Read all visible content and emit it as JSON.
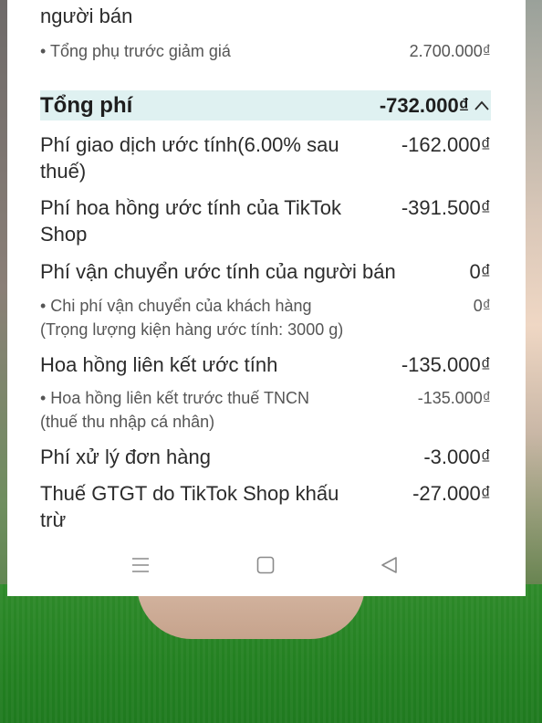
{
  "top_partial": {
    "line2": "người bán"
  },
  "subtotal": {
    "label": "• Tổng phụ trước giảm giá",
    "value": "2.700.000₫"
  },
  "total": {
    "label": "Tổng phí",
    "value": "-732.000₫"
  },
  "fees": [
    {
      "label_line1": "Phí giao dịch ước tính(6.00% sau",
      "label_line2": "thuế)",
      "value": "-162.000₫"
    },
    {
      "label_line1": "Phí hoa hồng ước tính của TikTok",
      "label_line2": "Shop",
      "value": "-391.500₫"
    },
    {
      "label_line1": "Phí vận chuyển ước tính của người bán",
      "value": "0₫"
    }
  ],
  "shipping_sub": {
    "label_line1": "• Chi phí vận chuyển của khách hàng",
    "label_line2": "(Trọng lượng kiện hàng ước tính: 3000 g)",
    "value": "0₫"
  },
  "affiliate": {
    "label": "Hoa hồng liên kết ước tính",
    "value": "-135.000₫"
  },
  "affiliate_sub": {
    "label_line1": "• Hoa hồng liên kết trước thuế TNCN",
    "label_line2": "(thuế thu nhập cá nhân)",
    "value": "-135.000₫"
  },
  "processing": {
    "label": "Phí xử lý đơn hàng",
    "value": "-3.000₫"
  },
  "vat": {
    "label_line1": "Thuế GTGT do TikTok Shop khấu",
    "label_line2": "trừ",
    "value": "-27.000₫"
  },
  "nav": {
    "menu_icon": "menu-icon",
    "home_icon": "home-square-icon",
    "back_icon": "back-triangle-icon"
  },
  "colors": {
    "total_bar_bg": "#dff1f1",
    "text": "#2b2b2b"
  }
}
